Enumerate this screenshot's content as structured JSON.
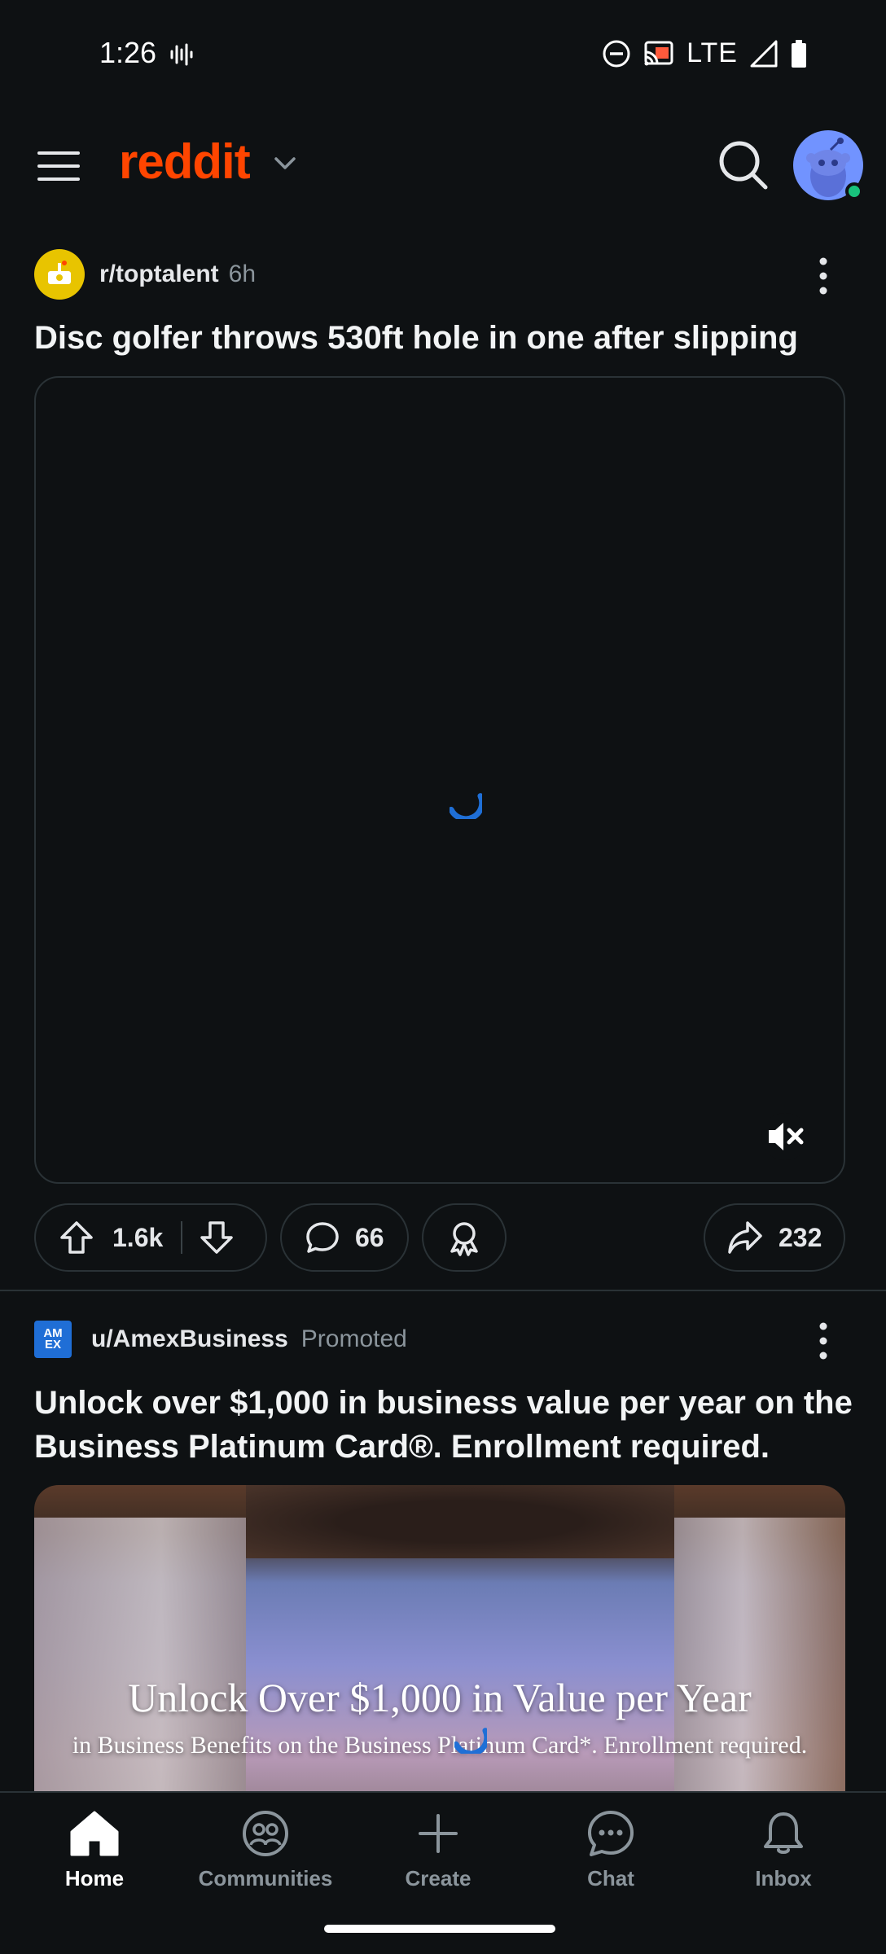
{
  "status_bar": {
    "time": "1:26",
    "network": "LTE"
  },
  "header": {
    "logo_text": "reddit"
  },
  "posts": [
    {
      "subreddit": "r/toptalent",
      "age": "6h",
      "title": "Disc golfer throws 530ft hole in one after slipping",
      "upvotes": "1.6k",
      "comments": "66",
      "shares": "232"
    },
    {
      "author": "u/AmexBusiness",
      "tag": "Promoted",
      "logo_text": "AM EX",
      "title": "Unlock over $1,000 in business value per year on the Business Platinum Card®. Enrollment required.",
      "ad_headline": "Unlock Over $1,000 in Value per Year",
      "ad_subline": "in Business Benefits on the Business Platinum Card*. Enrollment required."
    }
  ],
  "bottom_nav": [
    {
      "label": "Home",
      "icon": "home-icon",
      "active": true
    },
    {
      "label": "Communities",
      "icon": "communities-icon",
      "active": false
    },
    {
      "label": "Create",
      "icon": "plus-icon",
      "active": false
    },
    {
      "label": "Chat",
      "icon": "chat-icon",
      "active": false
    },
    {
      "label": "Inbox",
      "icon": "bell-icon",
      "active": false
    }
  ],
  "colors": {
    "brand": "#ff4500",
    "background": "#0e1113",
    "spinner": "#1f6fd6"
  }
}
